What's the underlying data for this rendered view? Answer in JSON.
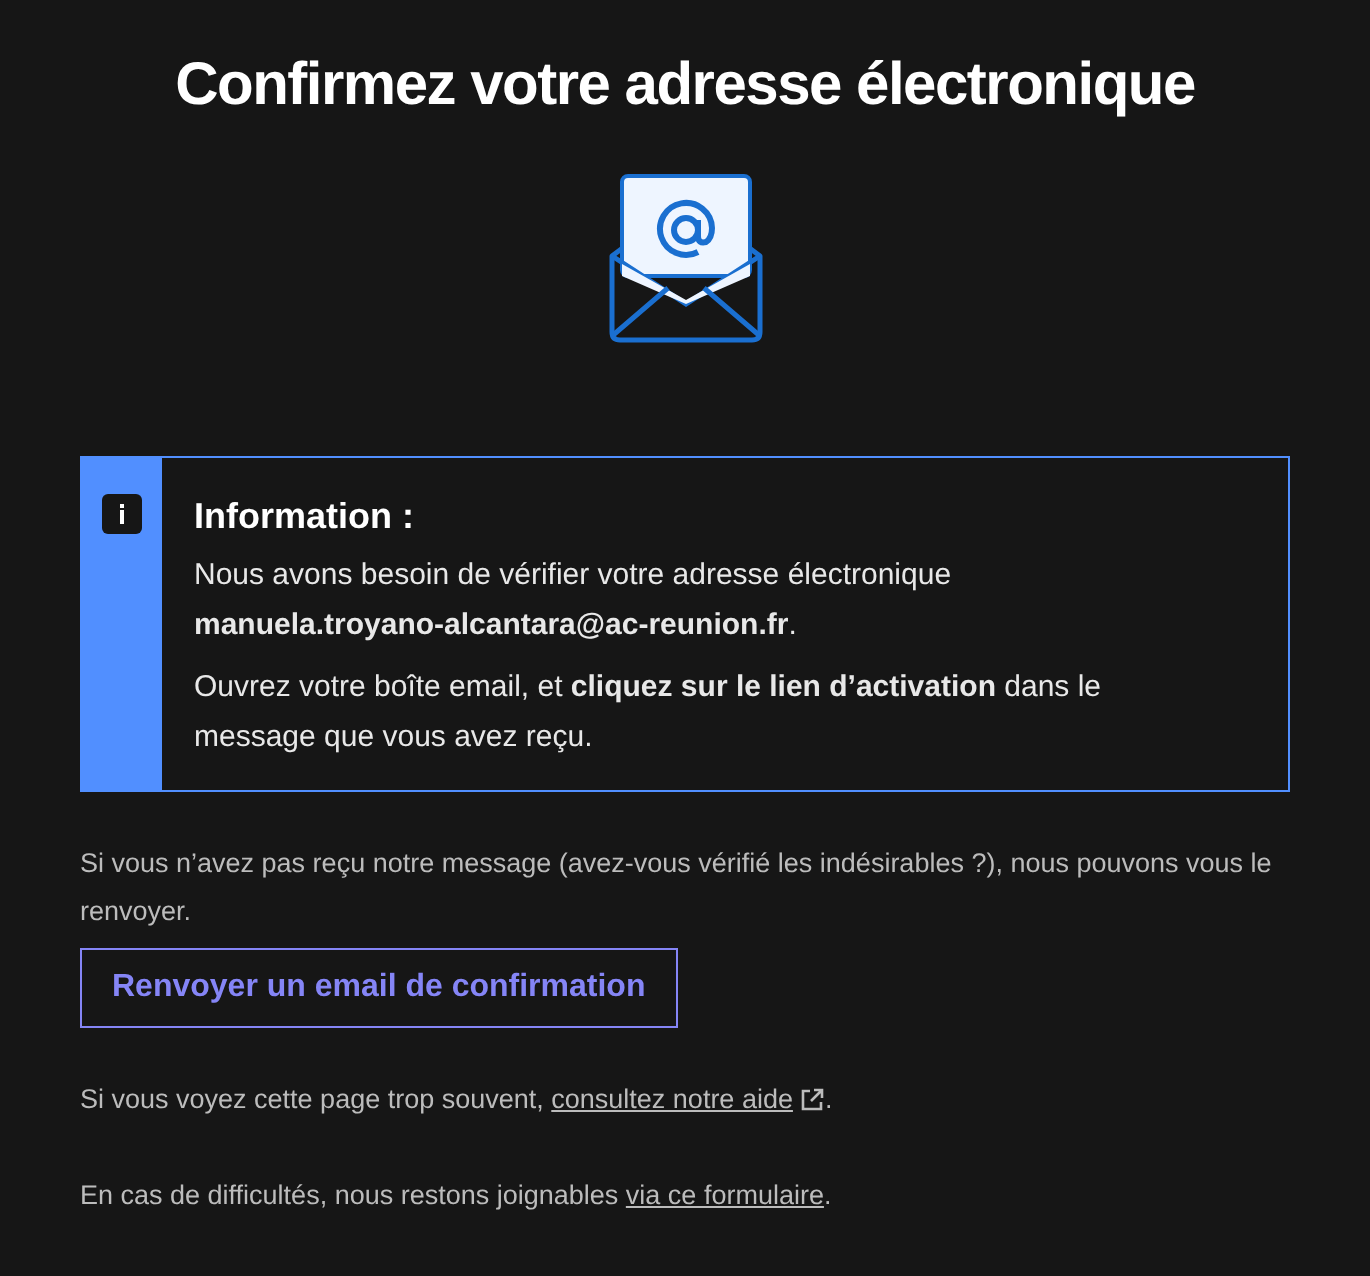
{
  "title": "Confirmez votre adresse électronique",
  "notice": {
    "heading": "Information :",
    "paragraphs": [
      "Nous avons besoin de vérifier votre adresse électronique **manuela.troyano-alcantara@ac-reunion.fr**.",
      "Ouvrez votre boîte email, et **cliquez sur le lien d’activation** dans le message que vous avez reçu."
    ]
  },
  "resend_text": "Si vous n’avez pas reçu notre message (avez-vous vérifié les indésirables ?), nous pouvons vous le renvoyer.",
  "resend_button": "Renvoyer un email de confirmation",
  "help": {
    "before": "Si vous voyez cette page trop souvent, ",
    "link": "consultez notre aide",
    "after": "."
  },
  "contact": {
    "before": "En cas de difficultés, nous restons joignables ",
    "link": "via ce formulaire",
    "after": "."
  }
}
